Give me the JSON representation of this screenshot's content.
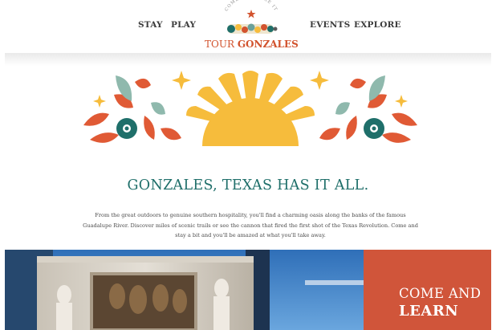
{
  "nav": {
    "left": [
      "STAY",
      "PLAY"
    ],
    "right": [
      "EVENTS",
      "EXPLORE"
    ]
  },
  "logo": {
    "arc_text": "COME AND TAKE IT",
    "name_part1": "TOUR ",
    "name_part2": "GONZALES"
  },
  "main": {
    "headline": "GONZALES, TEXAS HAS IT ALL.",
    "intro": "From the great outdoors to genuine southern hospitality, you'll find a charming oasis along the banks of the famous Guadalupe River. Discover miles of scenic trails or see the cannon that fired the first shot of the Texas Revolution. Come and stay a bit and you'll be amazed at what you'll take away."
  },
  "cta": {
    "line1": "COME AND",
    "line2": "LEARN"
  },
  "colors": {
    "brand_orange": "#d2532e",
    "teal": "#1f6f6a",
    "sun_yellow": "#f6bc3c",
    "cta_background": "#d0553a"
  }
}
